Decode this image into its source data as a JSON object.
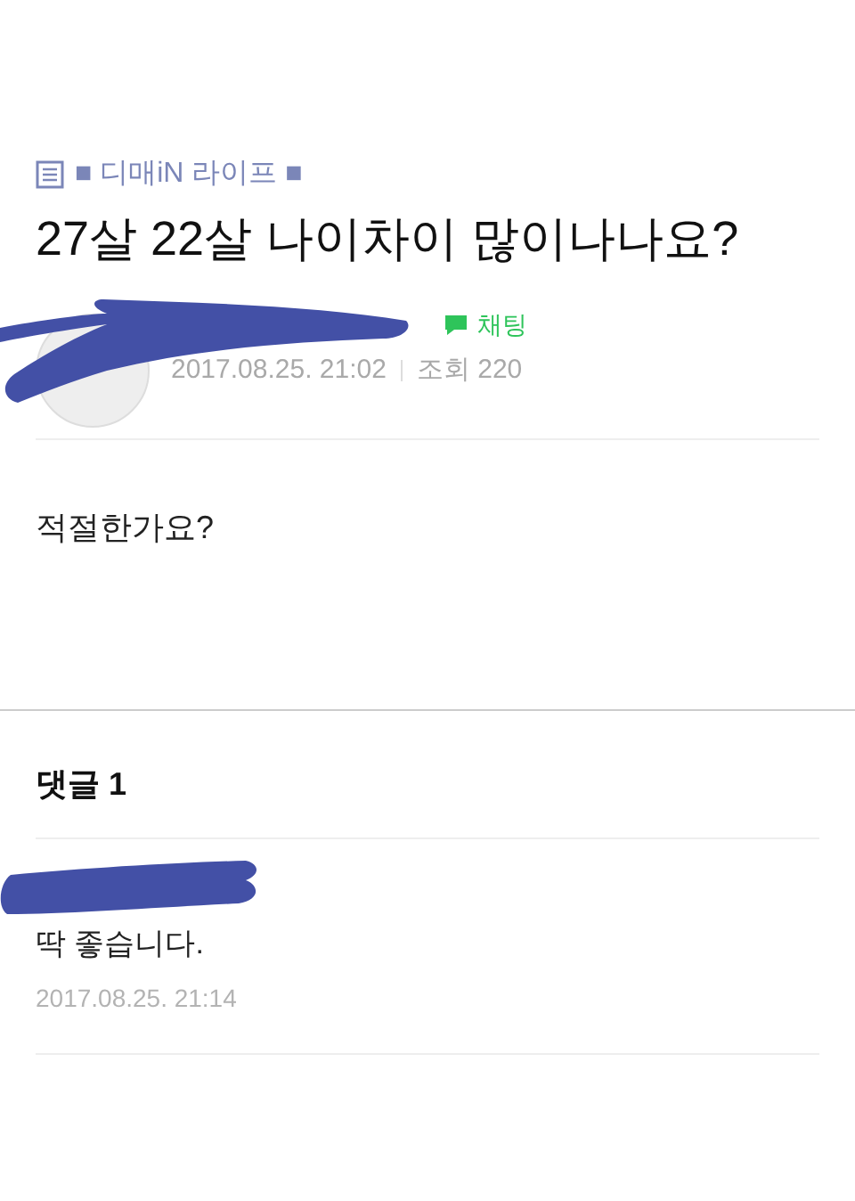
{
  "category": "■ 디매iN 라이프 ■",
  "post": {
    "title": "27살 22살 나이차이 많이나나요?",
    "chat_label": "채팅",
    "date": "2017.08.25. 21:02",
    "views": "조회 220",
    "body": "적절한가요?"
  },
  "comments": {
    "heading": "댓글 1",
    "items": [
      {
        "text": "딱 좋습니다.",
        "date": "2017.08.25. 21:14"
      }
    ]
  }
}
